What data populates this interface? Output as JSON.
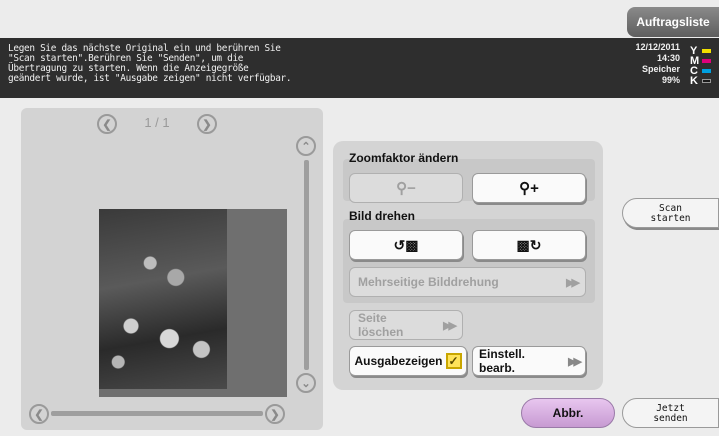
{
  "header": {
    "jobs_button": "Auftragsliste"
  },
  "message": {
    "lines": [
      "Legen Sie das nächste Original ein und berühren Sie",
      "\"Scan starten\".Berühren Sie \"Senden\", um die",
      "Übertragung zu starten. Wenn die Anzeigegröße",
      "geändert wurde, ist \"Ausgabe zeigen\" nicht verfügbar."
    ]
  },
  "status": {
    "date": "12/12/2011",
    "time": "14:30",
    "memory_label": "Speicher",
    "memory_value": "99%",
    "toner": [
      {
        "letter": "Y",
        "color": "#f2e000"
      },
      {
        "letter": "M",
        "color": "#e0007a"
      },
      {
        "letter": "C",
        "color": "#00a0e0"
      },
      {
        "letter": "K",
        "color": "#1a1a1a"
      }
    ]
  },
  "preview": {
    "page_indicator": "1 / 1"
  },
  "panel": {
    "zoom_title": "Zoomfaktor ändern",
    "rotate_title": "Bild drehen",
    "multipage_rotate": "Mehrseitige Bilddrehung",
    "delete_page": "Seite löschen",
    "output_display": "Ausgabezeigen",
    "edit_settings": "Einstell. bearb."
  },
  "actions": {
    "scan_start_l1": "Scan",
    "scan_start_l2": "starten",
    "cancel": "Abbr.",
    "send_now_l1": "Jetzt",
    "send_now_l2": "senden"
  }
}
